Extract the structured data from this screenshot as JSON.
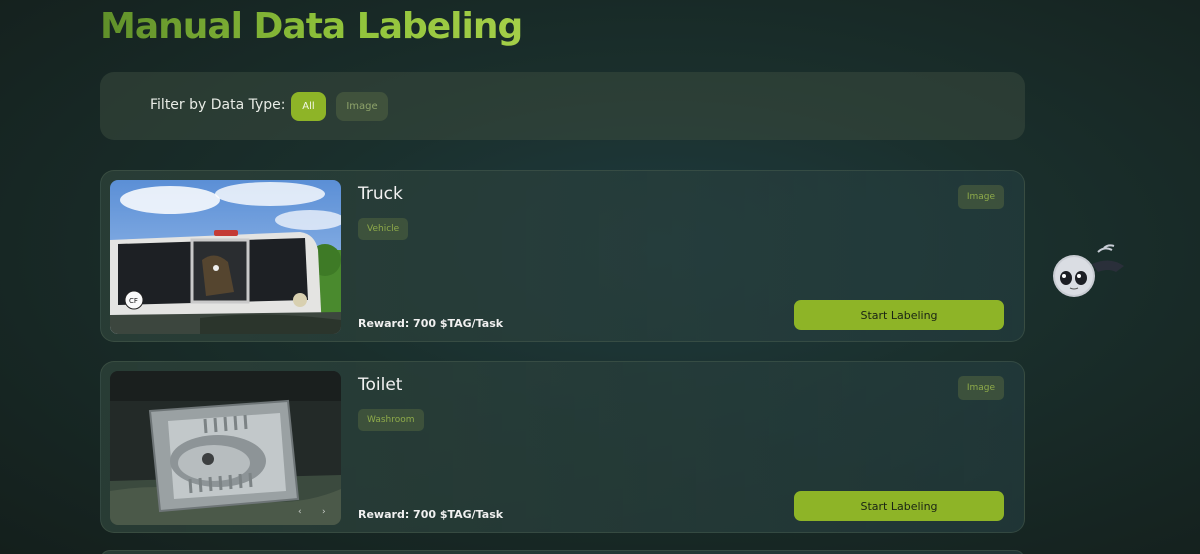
{
  "page": {
    "title": "Manual Data Labeling"
  },
  "filter": {
    "label": "Filter by Data Type:",
    "options": [
      "All",
      "Image"
    ],
    "selected": "All"
  },
  "tasks": [
    {
      "title": "Truck",
      "category": "Vehicle",
      "type": "Image",
      "reward": "Reward: 700 $TAG/Task",
      "button_label": "Start Labeling",
      "thumbnail_icon": "truck-photo"
    },
    {
      "title": "Toilet",
      "category": "Washroom",
      "type": "Image",
      "reward": "Reward: 700 $TAG/Task",
      "button_label": "Start Labeling",
      "thumbnail_icon": "squat-toilet-photo"
    }
  ],
  "colors": {
    "accent": "#8eb427",
    "title_gradient_start": "#5f8f2a",
    "title_gradient_end": "#a4cf48",
    "tag_text": "#8eaa4a"
  },
  "mascot_icon": "alien-mascot-icon"
}
